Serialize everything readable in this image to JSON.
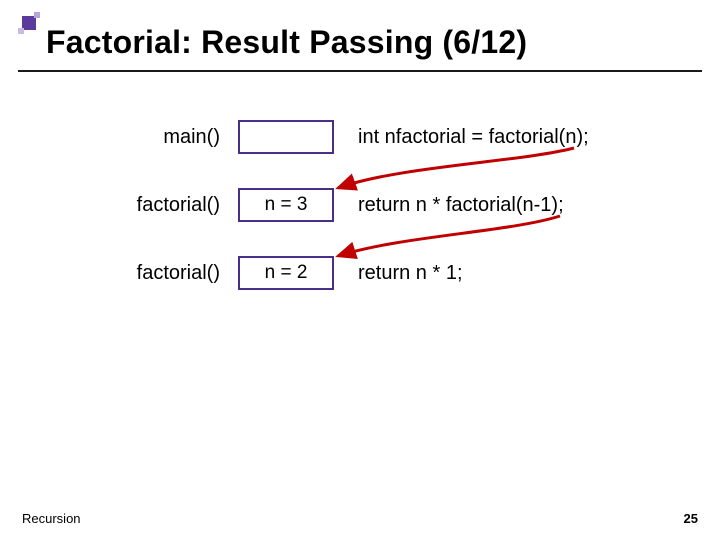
{
  "title": "Factorial: Result Passing (6/12)",
  "rows": [
    {
      "fn": "main()",
      "box": "",
      "code": "int nfactorial = factorial(n);"
    },
    {
      "fn": "factorial()",
      "box": "n = 3",
      "code": "return n * factorial(n-1);"
    },
    {
      "fn": "factorial()",
      "box": "n = 2",
      "code": "return n * 1;"
    }
  ],
  "footer": {
    "left": "Recursion",
    "page": "25"
  },
  "colors": {
    "boxBorder": "#4a2f8a",
    "arrow": "#c00000"
  }
}
